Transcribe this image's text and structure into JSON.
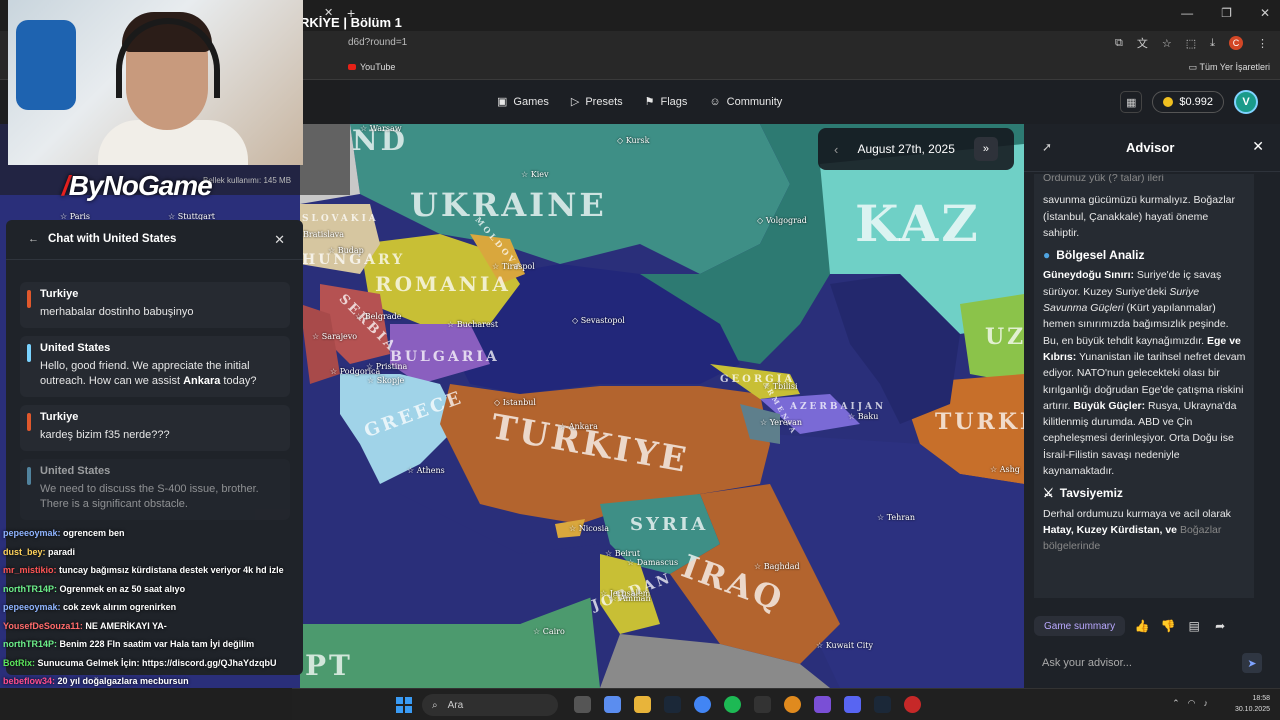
{
  "browser": {
    "tab_title": "RKİYE | Bölüm 1",
    "url_fragment": "d6d?round=1",
    "bookmark_youtube": "YouTube",
    "bookmark_all": "Tüm Yer İşaretleri",
    "profile_initial": "C"
  },
  "nav": {
    "items": [
      {
        "icon": "▣",
        "label": "Games"
      },
      {
        "icon": "▷",
        "label": "Presets"
      },
      {
        "icon": "⚑",
        "label": "Flags"
      },
      {
        "icon": "☺",
        "label": "Community"
      }
    ],
    "balance": "$0.992",
    "avatar_initial": "V"
  },
  "map": {
    "date": "August 27th, 2025",
    "countries": [
      "UKRAINE",
      "ROMANIA",
      "SERBIA",
      "BULGARIA",
      "GREECE",
      "TURKIYE",
      "SYRIA",
      "IRAQ",
      "GEORGIA",
      "AZERBAIJAN",
      "ARMENIA",
      "TURKMEN",
      "KAZ",
      "JORDAN",
      "HUNGARY",
      "SLOVAKIA",
      "MOLDOVA",
      "UZ",
      "ND",
      "PT"
    ],
    "cities": [
      "Warsaw",
      "Kursk",
      "Kiev",
      "Volgograd",
      "Bratislava",
      "Budap",
      "Tiraspol",
      "Bucharest",
      "Sevastopol",
      "Belgrade",
      "Sarajevo",
      "Podgorica",
      "Pristina",
      "Skopje",
      "Istanbul",
      "Ankara",
      "Tbilisi",
      "Yerevan",
      "Baku",
      "Athens",
      "Nicosia",
      "Beirut",
      "Damascus",
      "Jerusalem",
      "Amman",
      "Baghdad",
      "Tehran",
      "Cairo",
      "Kuwait City",
      "Ashg",
      "Paris",
      "Stuttgart"
    ]
  },
  "advisor": {
    "title": "Advisor",
    "intro_cut": "Ordumuz yük (? talar) ileri",
    "intro": "savunma gücümüzü kurmalıyız. Boğazlar (İstanbul, Çanakkale) hayati öneme sahiptir.",
    "section1_title": "Bölgesel Analiz",
    "s1_label1": "Güneydoğu Sınırı:",
    "s1_text1": " Suriye'de iç savaş sürüyor. Kuzey Suriye'deki ",
    "s1_italic": "Suriye Savunma Güçleri",
    "s1_text2": " (Kürt yapılanmalar) hemen sınırımızda bağımsızlık peşinde. Bu, en büyük tehdit kaynağımızdır. ",
    "s1_label2": "Ege ve Kıbrıs:",
    "s1_text3": " Yunanistan ile tarihsel nefret devam ediyor. NATO'nun gelecekteki olası bir kırılganlığı doğrudan Ege'de çatışma riskini artırır. ",
    "s1_label3": "Büyük Güçler:",
    "s1_text4": " Rusya, Ukrayna'da kilitlenmiş durumda. ABD ve Çin cepheleşmesi derinleşiyor. Orta Doğu ise İsrail-Filistin savaşı nedeniyle kaynamaktadır.",
    "section2_title": "Tavsiyemiz",
    "s2_text1": "Derhal ordumuzu kurmaya ve acil olarak ",
    "s2_bold": "Hatay, Kuzey Kürdistan, ve",
    "s2_cut": "Boğazlar bölgelerinde",
    "summary_button": "Game summary",
    "input_placeholder": "Ask your advisor..."
  },
  "chat": {
    "title": "Chat with United States",
    "messages": [
      {
        "sender": "Turkiye",
        "color": "#e0582c",
        "text": "merhabalar dostinho babuşinyo"
      },
      {
        "sender": "United States",
        "color": "#7ad3ff",
        "text_pre": "Hello, good friend. We appreciate the initial outreach. How can we assist ",
        "text_bold": "Ankara",
        "text_post": " today?"
      },
      {
        "sender": "Turkiye",
        "color": "#e0582c",
        "text": "kardeş bizim f35 nerde???"
      },
      {
        "sender": "United States",
        "color": "#7ad3ff",
        "text": "We need to discuss the S-400 issue, brother. There is a significant obstacle."
      }
    ]
  },
  "stream": {
    "memory_text": "Bellek kullanımı: 145 MB",
    "logo": "ByNoGame",
    "chat": [
      {
        "user": "pepeeoymak:",
        "color": "#8fb4ff",
        "text": " ogrencem ben"
      },
      {
        "user": "dust_bey:",
        "color": "#ffd35c",
        "text": " paradi"
      },
      {
        "user": "mr_mistikio:",
        "color": "#ff5555",
        "text": " tuncay bağımsız kürdistana destek veriyor 4k hd izle"
      },
      {
        "user": "northTR14P:",
        "color": "#6cf08a",
        "text": " Ogrenmek en az 50 saat alıyo"
      },
      {
        "user": "pepeeoymak:",
        "color": "#8fb4ff",
        "text": " cok zevk alırım ogrenirken"
      },
      {
        "user": "YousefDeSouza11:",
        "color": "#ff6b6b",
        "text": " NE AMERİKAYI YA-"
      },
      {
        "user": "northTR14P:",
        "color": "#6cf08a",
        "text": " Benim 228 Fln saatim var Hala tam İyi değilim"
      },
      {
        "user": "BotRix:",
        "color": "#5ce65c",
        "text": " Sunucuma Gelmek İçin: https://discord.gg/QJhaYdzqbU"
      },
      {
        "user": "bebeflow34:",
        "color": "#ff4d8d",
        "text": " 20 yıl doğalgazlara mecbursun"
      }
    ]
  },
  "taskbar": {
    "search_label": "Ara",
    "time": "18:58",
    "date": "30.10.2025"
  },
  "colors": {
    "sea": "#2a2f7a",
    "turkiye": "#b3642e",
    "accent": "#7fa4ff"
  }
}
